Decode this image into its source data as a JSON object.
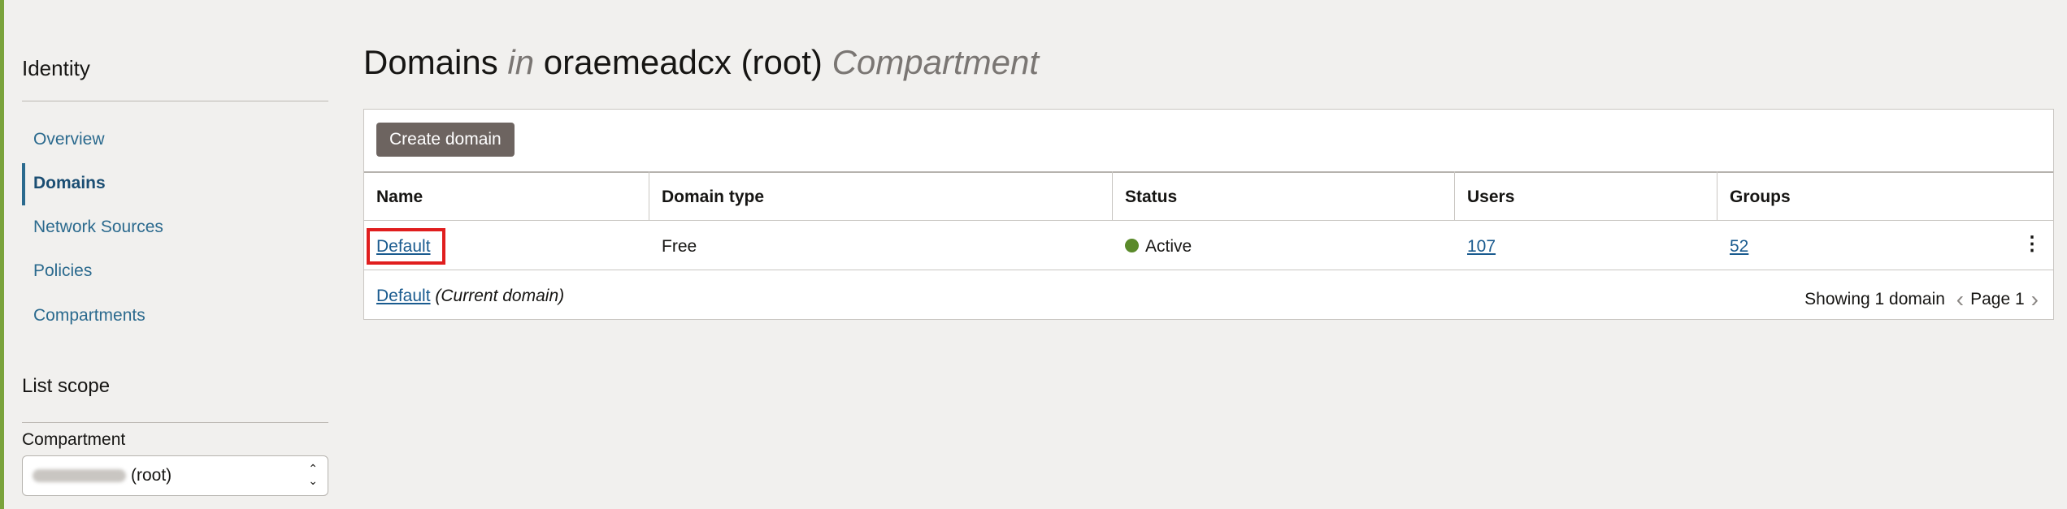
{
  "sidebar": {
    "heading": "Identity",
    "items": [
      {
        "label": "Overview"
      },
      {
        "label": "Domains"
      },
      {
        "label": "Network Sources"
      },
      {
        "label": "Policies"
      },
      {
        "label": "Compartments"
      }
    ],
    "active_item": "Domains",
    "scope_heading": "List scope",
    "compartment_label": "Compartment",
    "compartment_value": "(root)"
  },
  "header": {
    "title_prefix": "Domains",
    "title_in": "in",
    "title_name": "oraemeadcx (root)",
    "title_suffix": "Compartment"
  },
  "toolbar": {
    "create_label": "Create domain"
  },
  "table": {
    "columns": [
      "Name",
      "Domain type",
      "Status",
      "Users",
      "Groups"
    ],
    "rows": [
      {
        "name": "Default",
        "domain_type": "Free",
        "status": "Active",
        "users": "107",
        "groups": "52"
      }
    ]
  },
  "footer": {
    "current_domain_link": "Default",
    "current_domain_note": "(Current domain)",
    "showing": "Showing 1 domain",
    "page": "Page 1"
  },
  "colors": {
    "accent_green": "#7aa33c",
    "link": "#1a5b8f",
    "status_active": "#5a8a2a",
    "highlight": "#e01e1e",
    "button": "#6d6460"
  },
  "icons": {
    "prev": "chevron-left-icon",
    "next": "chevron-right-icon",
    "actions": "kebab-menu-icon",
    "select": "updown-chevron-icon"
  }
}
